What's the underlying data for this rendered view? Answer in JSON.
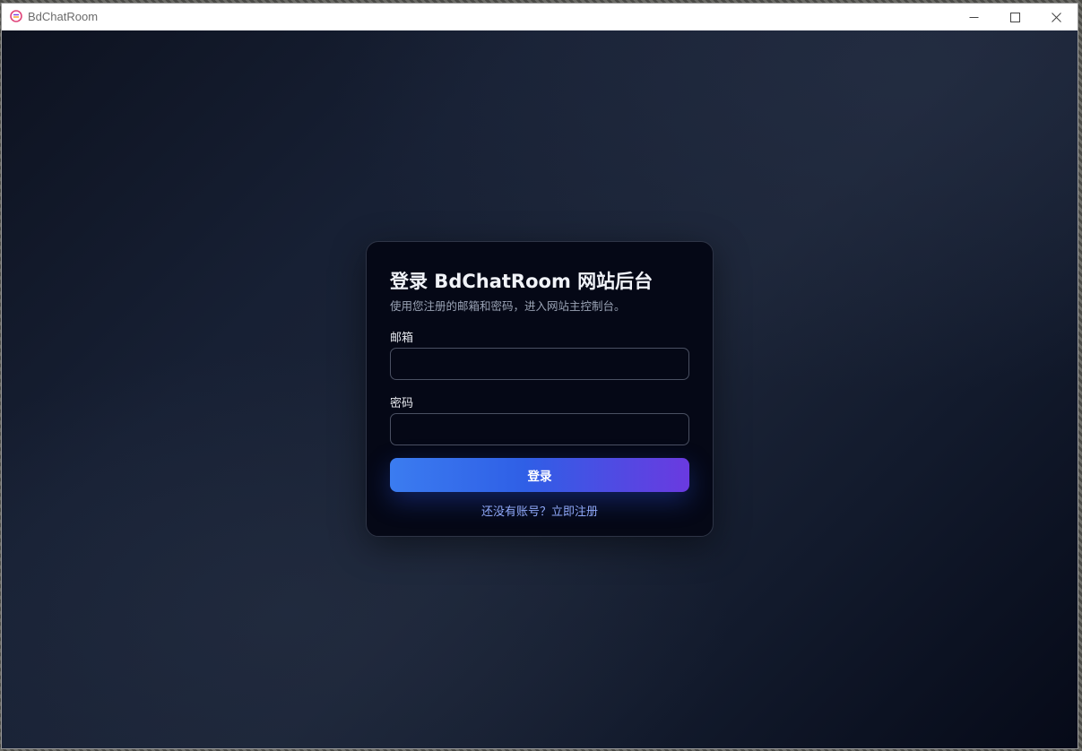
{
  "window": {
    "title": "BdChatRoom",
    "app_icon": "chat-logo-icon",
    "controls": {
      "minimize": "minimize-icon",
      "maximize": "maximize-icon",
      "close": "close-icon"
    }
  },
  "login": {
    "title": "登录 BdChatRoom 网站后台",
    "subtitle": "使用您注册的邮箱和密码，进入网站主控制台。",
    "email_label": "邮箱",
    "email_value": "",
    "password_label": "密码",
    "password_value": "",
    "submit_label": "登录",
    "register_text": "还没有账号？立即注册"
  },
  "colors": {
    "accent_start": "#3b7cf0",
    "accent_end": "#6a3ae0",
    "link": "#8fa8f8",
    "card_bg": "#050816"
  }
}
